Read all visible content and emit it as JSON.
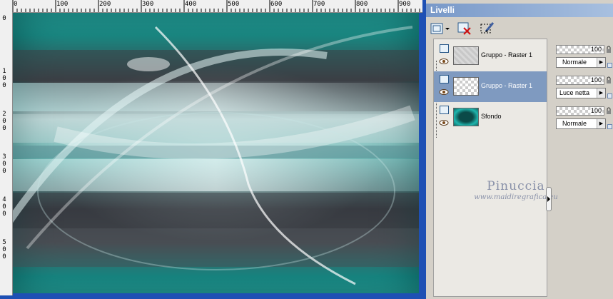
{
  "ruler": {
    "top_labels": [
      "0",
      "100",
      "200",
      "300",
      "400",
      "500",
      "600",
      "700",
      "800",
      "900"
    ],
    "left_labels": [
      [
        "0"
      ],
      [
        "1",
        "0",
        "0"
      ],
      [
        "2",
        "0",
        "0"
      ],
      [
        "3",
        "0",
        "0"
      ],
      [
        "4",
        "0",
        "0"
      ],
      [
        "5",
        "0",
        "0"
      ]
    ]
  },
  "panel": {
    "title": "Livelli",
    "toolbar_icons": [
      "new-raster-layer-icon",
      "delete-layer-icon",
      "edit-selection-icon"
    ]
  },
  "layers": [
    {
      "name": "Gruppo - Raster 1",
      "opacity": "100",
      "blend": "Normale",
      "selected": false
    },
    {
      "name": "Gruppo - Raster 1",
      "opacity": "100",
      "blend": "Luce netta",
      "selected": true
    },
    {
      "name": "Sfondo",
      "opacity": "100",
      "blend": "Normale",
      "selected": false
    }
  ],
  "watermark": {
    "name": "Pinuccia",
    "url": "www.maidiregrafica.eu"
  },
  "colors": {
    "teal": "#1f9e98",
    "selection": "#7f9ac0",
    "window_frame": "#1e50b4"
  }
}
